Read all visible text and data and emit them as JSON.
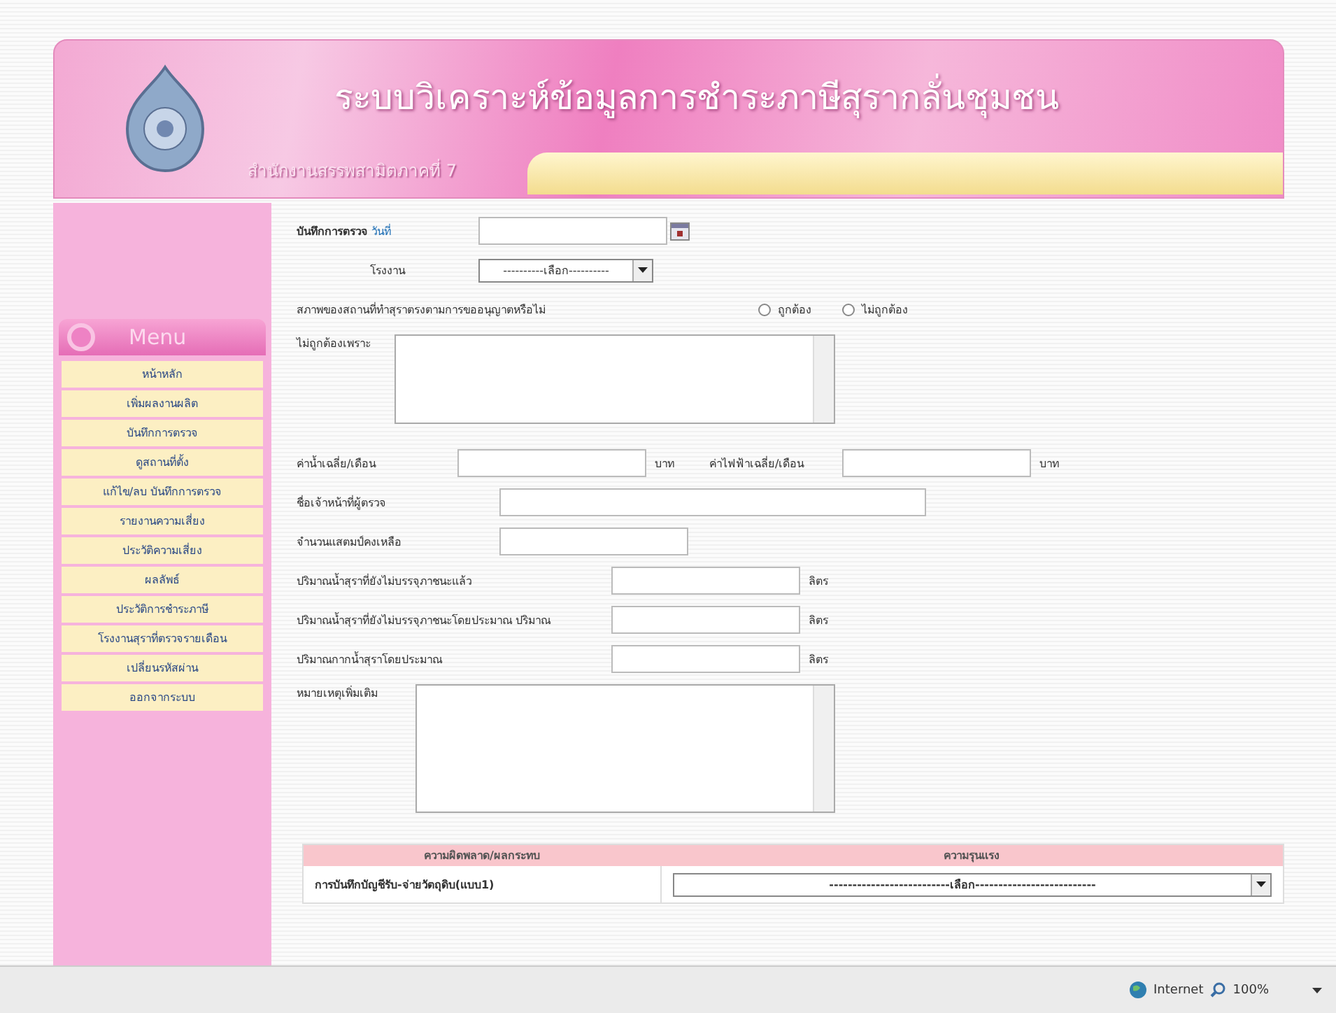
{
  "header": {
    "title": "ระบบวิเคราะห์ข้อมูลการชำระภาษีสุรากลั่นชุมชน",
    "subtitle": "สำนักงานสรรพสามิตภาคที่ 7"
  },
  "menu": {
    "title": "Menu",
    "items": [
      {
        "label": "หน้าหลัก"
      },
      {
        "label": "เพิ่มผลงานผลิต"
      },
      {
        "label": "บันทึกการตรวจ"
      },
      {
        "label": "ดูสถานที่ตั้ง"
      },
      {
        "label": "แก้ไข/ลบ บันทึกการตรวจ"
      },
      {
        "label": "รายงานความเสี่ยง"
      },
      {
        "label": "ประวัติความเสี่ยง"
      },
      {
        "label": "ผลลัพธ์"
      },
      {
        "label": "ประวัติการชำระภาษี"
      },
      {
        "label": "โรงงานสุราที่ตรวจรายเดือน"
      },
      {
        "label": "เปลี่ยนรหัสผ่าน"
      },
      {
        "label": "ออกจากระบบ"
      }
    ]
  },
  "form": {
    "title": "บันทึกการตรวจ",
    "date_label": "วันที่",
    "factory": {
      "label": "โรงงาน",
      "value": "----------เลือก----------"
    },
    "condition": {
      "question": "สภาพของสถานที่ทำสุราตรงตามการขออนุญาตหรือไม่",
      "options": [
        {
          "label": "ถูกต้อง",
          "selected": false
        },
        {
          "label": "ไม่ถูกต้อง",
          "selected": false
        }
      ]
    },
    "reason_label": "ไม่ถูกต้องเพราะ",
    "costs": [
      {
        "label": "ค่าน้ำเฉลี่ย/เดือน",
        "unit": "บาท"
      },
      {
        "label": "ค่าไฟฟ้าเฉลี่ย/เดือน",
        "unit": "บาท"
      }
    ],
    "inspector_label": "ชื่อเจ้าหน้าที่ผู้ตรวจ",
    "stamp_label": "จำนวนแสตมป์คงเหลือ",
    "quantities": [
      {
        "label": "ปริมาณน้ำสุราที่ยังไม่บรรจุภาชนะแล้ว",
        "unit": "ลิตร"
      },
      {
        "label": "ปริมาณน้ำสุราที่ยังไม่บรรจุภาชนะโดยประมาณ ปริมาณ",
        "unit": "ลิตร"
      },
      {
        "label": "ปริมาณกากน้ำสุราโดยประมาณ",
        "unit": "ลิตร"
      }
    ],
    "remarks_label": "หมายเหตุเพิ่มเติม"
  },
  "table": {
    "columns": [
      "ความผิดพลาด/ผลกระทบ",
      "ความรุนแรง"
    ],
    "rows": [
      {
        "item": "การบันทึกบัญชีรับ-จ่ายวัตถุดิบ(แบบ1)",
        "value": "--------------------------เลือก--------------------------"
      }
    ]
  },
  "status_bar": {
    "zone": "Internet",
    "zoom": "100%"
  }
}
